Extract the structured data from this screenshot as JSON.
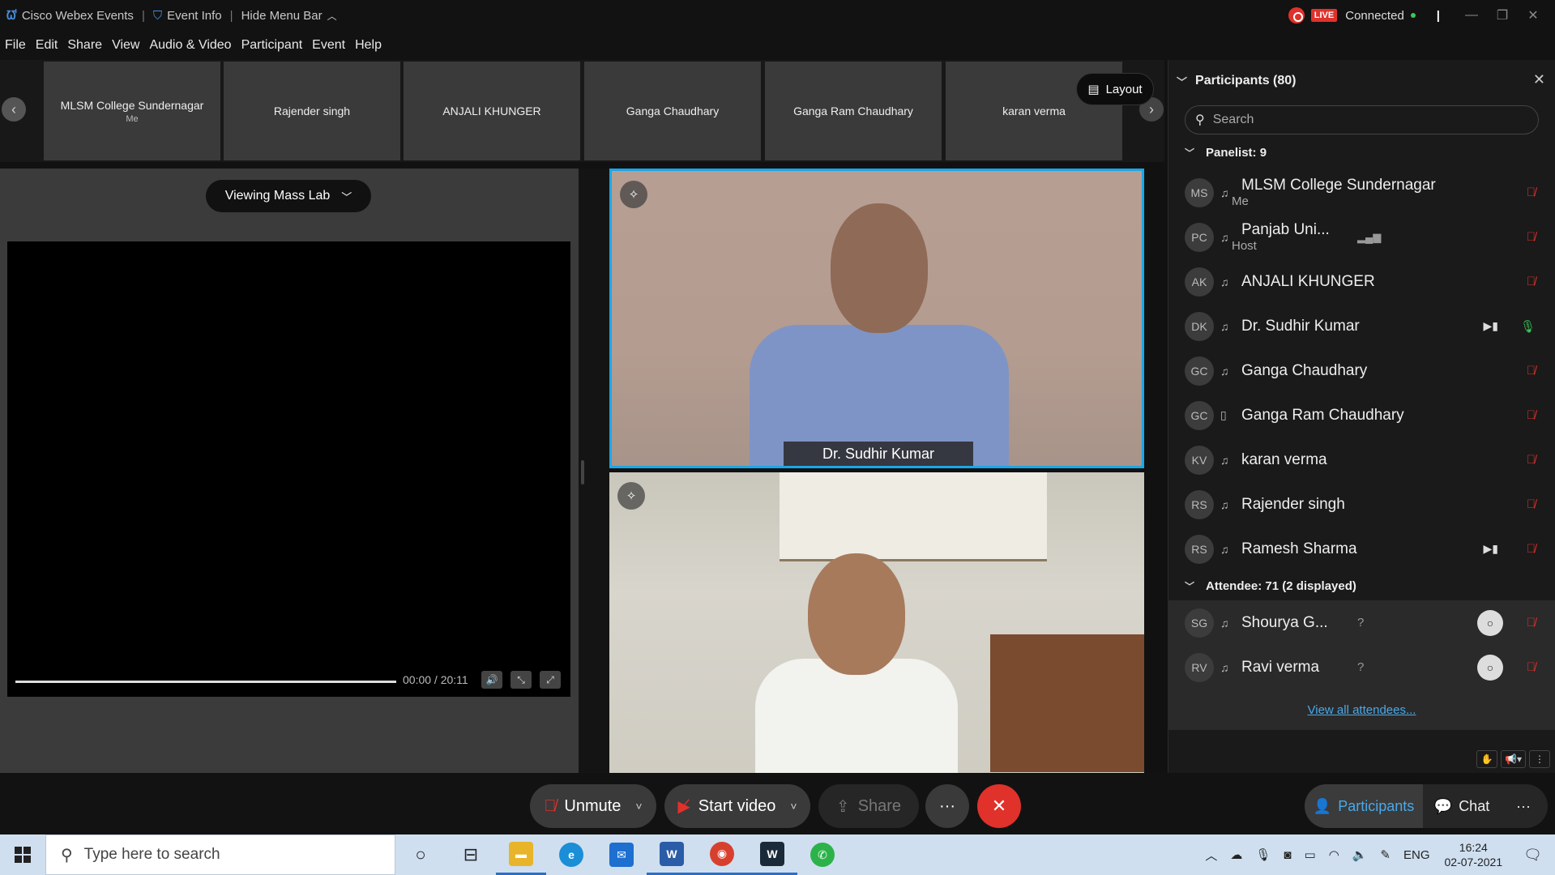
{
  "titlebar": {
    "app_name": "Cisco Webex Events",
    "event_info": "Event Info",
    "hide_menu": "Hide Menu Bar",
    "live": "LIVE",
    "status": "Connected"
  },
  "menu": [
    "File",
    "Edit",
    "Share",
    "View",
    "Audio & Video",
    "Participant",
    "Event",
    "Help"
  ],
  "filmstrip": [
    {
      "name": "MLSM College Sundernagar",
      "sub": "Me"
    },
    {
      "name": "Rajender singh",
      "sub": ""
    },
    {
      "name": "ANJALI KHUNGER",
      "sub": ""
    },
    {
      "name": "Ganga Chaudhary",
      "sub": ""
    },
    {
      "name": "Ganga Ram Chaudhary",
      "sub": ""
    },
    {
      "name": "karan verma",
      "sub": ""
    }
  ],
  "layout_label": "Layout",
  "share_view": {
    "viewing_label": "Viewing Mass Lab",
    "timecode": "00:00 / 20:11"
  },
  "video_tiles": [
    {
      "name": "Dr. Sudhir Kumar",
      "active": true
    },
    {
      "name": "",
      "active": false
    }
  ],
  "sidebar": {
    "title": "Participants (80)",
    "search_placeholder": "Search",
    "panelist_header": "Panelist: 9",
    "panelists": [
      {
        "initials": "MS",
        "name": "MLSM College Sundernagar",
        "role": "Me",
        "audio": "muted",
        "camera": false
      },
      {
        "initials": "PC",
        "name": "Panjab Uni...",
        "role": "Host",
        "audio": "muted",
        "camera": false
      },
      {
        "initials": "AK",
        "name": "ANJALI KHUNGER",
        "role": "",
        "audio": "muted",
        "camera": false
      },
      {
        "initials": "DK",
        "name": "Dr. Sudhir Kumar",
        "role": "",
        "audio": "unmuted",
        "camera": true
      },
      {
        "initials": "GC",
        "name": "Ganga Chaudhary",
        "role": "",
        "audio": "muted",
        "camera": false
      },
      {
        "initials": "GC",
        "name": "Ganga Ram Chaudhary",
        "role": "",
        "audio": "muted",
        "camera": false
      },
      {
        "initials": "KV",
        "name": "karan verma",
        "role": "",
        "audio": "muted",
        "camera": false
      },
      {
        "initials": "RS",
        "name": "Rajender singh",
        "role": "",
        "audio": "muted",
        "camera": false
      },
      {
        "initials": "RS",
        "name": "Ramesh Sharma",
        "role": "",
        "audio": "muted",
        "camera": true
      }
    ],
    "attendee_header": "Attendee: 71 (2 displayed)",
    "attendees": [
      {
        "initials": "SG",
        "name": "Shourya G...",
        "status": "?"
      },
      {
        "initials": "RV",
        "name": "Ravi verma",
        "status": "?"
      }
    ],
    "view_all": "View all attendees..."
  },
  "toolbar": {
    "unmute": "Unmute",
    "start_video": "Start video",
    "share": "Share",
    "more": "···",
    "participants_tab": "Participants",
    "chat_tab": "Chat"
  },
  "taskbar": {
    "search_placeholder": "Type here to search",
    "lang": "ENG",
    "time": "16:24",
    "date": "02-07-2021"
  },
  "colors": {
    "accent_blue": "#1aa7e8",
    "danger_red": "#e0312b",
    "ok_green": "#3cc65a"
  }
}
